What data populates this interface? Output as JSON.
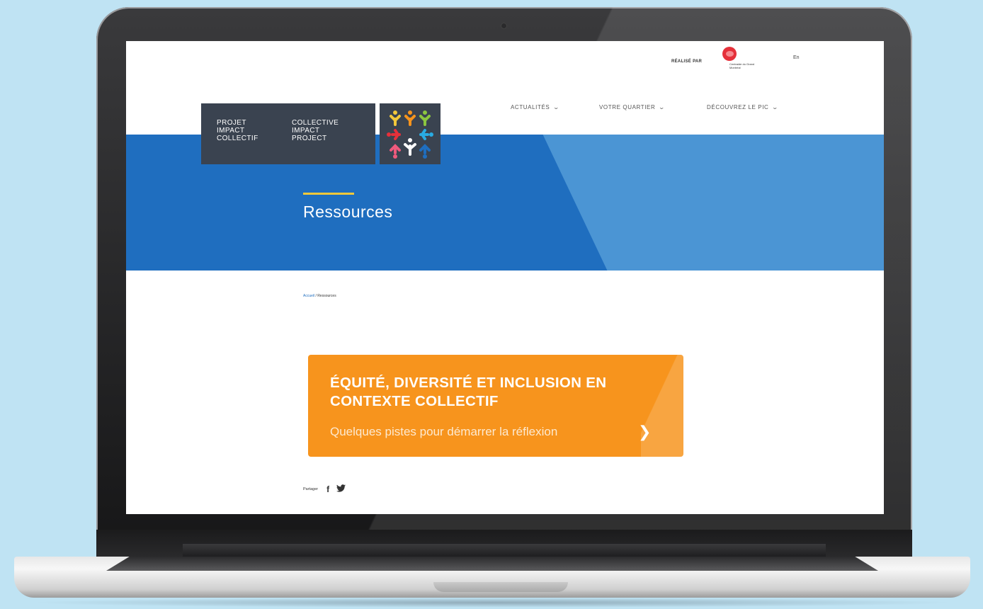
{
  "topbar": {
    "realise_label": "RÉALISÉ PAR",
    "partner_name": "Centraide du Grand Montréal",
    "language_link": "En"
  },
  "logo": {
    "col1": [
      "PROJET",
      "IMPACT",
      "COLLECTIF"
    ],
    "col2": [
      "COLLECTIVE",
      "IMPACT",
      "PROJECT"
    ]
  },
  "nav": {
    "items": [
      "ACTUALITÉS",
      "VOTRE QUARTIER",
      "DÉCOUVREZ LE PIC"
    ]
  },
  "hero": {
    "title": "Ressources",
    "accent_color": "#f2c83a",
    "background_color": "#1f6ebf"
  },
  "breadcrumb": {
    "home": "Accueil",
    "separator": "/",
    "current": "Ressources"
  },
  "cta": {
    "title": "ÉQUITÉ, DIVERSITÉ ET INCLUSION EN CONTEXTE COLLECTIF",
    "subtitle": "Quelques pistes pour démarrer la réflexion",
    "color": "#f7941d"
  },
  "share": {
    "label": "Partager",
    "icons": [
      "facebook-icon",
      "twitter-icon"
    ]
  }
}
